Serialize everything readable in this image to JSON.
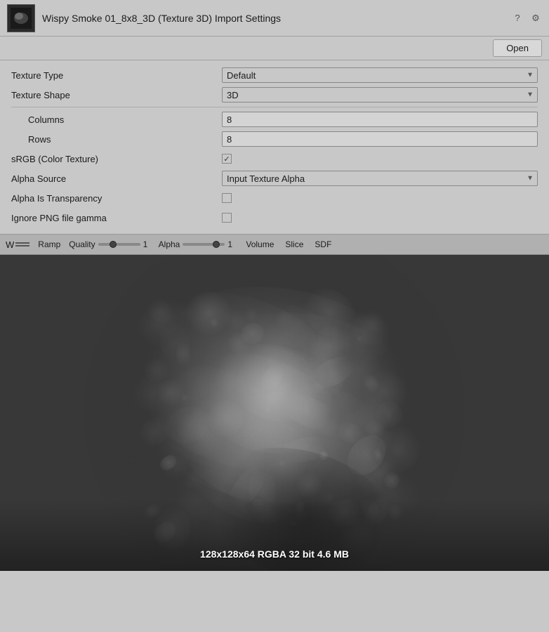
{
  "window": {
    "title": "Wispy Smoke 01_8x8_3D (Texture 3D) Import Settings",
    "open_button": "Open"
  },
  "settings": {
    "texture_type_label": "Texture Type",
    "texture_type_value": "Default",
    "texture_shape_label": "Texture Shape",
    "texture_shape_value": "3D",
    "columns_label": "Columns",
    "columns_value": "8",
    "rows_label": "Rows",
    "rows_value": "8",
    "srgb_label": "sRGB (Color Texture)",
    "alpha_source_label": "Alpha Source",
    "alpha_source_value": "Input Texture Alpha",
    "alpha_is_transparency_label": "Alpha Is Transparency",
    "ignore_png_label": "Ignore PNG file gamma"
  },
  "toolbar": {
    "w_label": "W",
    "ramp_label": "Ramp",
    "quality_label": "Quality",
    "quality_value": "1",
    "alpha_label": "Alpha",
    "alpha_value": "1",
    "volume_label": "Volume",
    "slice_label": "Slice",
    "sdf_label": "SDF"
  },
  "preview": {
    "info_text": "128x128x64 RGBA 32 bit 4.6 MB"
  }
}
